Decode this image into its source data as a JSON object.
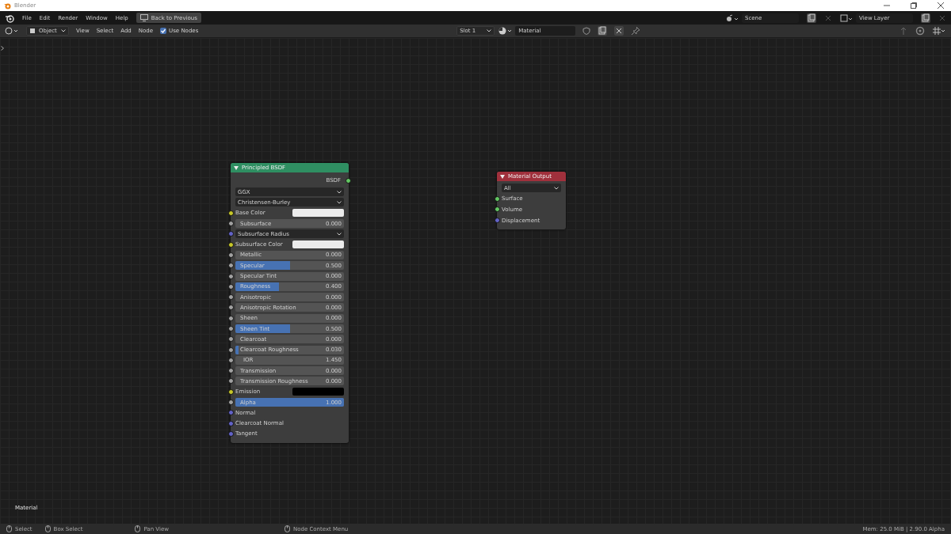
{
  "title_bar": {
    "title": "Blender"
  },
  "menu_bar": {
    "items": [
      "File",
      "Edit",
      "Render",
      "Window",
      "Help"
    ],
    "back_button": "Back to Previous",
    "scene": "Scene",
    "view_layer": "View Layer"
  },
  "header": {
    "mode": "Object",
    "menus": [
      "View",
      "Select",
      "Add",
      "Node"
    ],
    "use_nodes": {
      "label": "Use Nodes",
      "checked": true
    },
    "slot": "Slot 1",
    "material": "Material"
  },
  "principled_node": {
    "title": "Principled BSDF",
    "output": {
      "label": "BSDF",
      "color": "#63c763"
    },
    "rows": [
      {
        "kind": "dropdown",
        "label": "GGX"
      },
      {
        "kind": "dropdown",
        "label": "Christensen-Burley"
      },
      {
        "kind": "color",
        "label": "Base Color",
        "socket": {
          "color": "#c7c729"
        },
        "color": "#ececec"
      },
      {
        "kind": "slider",
        "label": "Subsurface",
        "value": "0.000",
        "socket": {
          "color": "#a1a1a1"
        }
      },
      {
        "kind": "dropdown",
        "label": "Subsurface Radius",
        "socket": {
          "color": "#6363c7"
        }
      },
      {
        "kind": "color",
        "label": "Subsurface Color",
        "socket": {
          "color": "#c7c729"
        },
        "color": "#ececec"
      },
      {
        "kind": "slider",
        "label": "Metallic",
        "value": "0.000",
        "socket": {
          "color": "#a1a1a1"
        }
      },
      {
        "kind": "slider",
        "label": "Specular",
        "value": "0.500",
        "level": 0.5,
        "socket": {
          "color": "#a1a1a1"
        }
      },
      {
        "kind": "slider",
        "label": "Specular Tint",
        "value": "0.000",
        "socket": {
          "color": "#a1a1a1"
        }
      },
      {
        "kind": "slider",
        "label": "Roughness",
        "value": "0.400",
        "level": 0.4,
        "socket": {
          "color": "#a1a1a1"
        }
      },
      {
        "kind": "slider",
        "label": "Anisotropic",
        "value": "0.000",
        "socket": {
          "color": "#a1a1a1"
        }
      },
      {
        "kind": "slider",
        "label": "Anisotropic Rotation",
        "value": "0.000",
        "socket": {
          "color": "#a1a1a1"
        }
      },
      {
        "kind": "slider",
        "label": "Sheen",
        "value": "0.000",
        "socket": {
          "color": "#a1a1a1"
        }
      },
      {
        "kind": "slider",
        "label": "Sheen Tint",
        "value": "0.500",
        "level": 0.5,
        "socket": {
          "color": "#a1a1a1"
        }
      },
      {
        "kind": "slider",
        "label": "Clearcoat",
        "value": "0.000",
        "socket": {
          "color": "#a1a1a1"
        }
      },
      {
        "kind": "slider",
        "label": "Clearcoat Roughness",
        "value": "0.030",
        "level": 0.03,
        "socket": {
          "color": "#a1a1a1"
        }
      },
      {
        "kind": "number",
        "label": "IOR",
        "value": "1.450",
        "socket": {
          "color": "#a1a1a1"
        }
      },
      {
        "kind": "slider",
        "label": "Transmission",
        "value": "0.000",
        "socket": {
          "color": "#a1a1a1"
        }
      },
      {
        "kind": "slider",
        "label": "Transmission Roughness",
        "value": "0.000",
        "socket": {
          "color": "#a1a1a1"
        }
      },
      {
        "kind": "color",
        "label": "Emission",
        "socket": {
          "color": "#c7c729"
        },
        "color": "#000000"
      },
      {
        "kind": "slider",
        "label": "Alpha",
        "value": "1.000",
        "level": 1,
        "socket": {
          "color": "#a1a1a1"
        }
      },
      {
        "kind": "input",
        "label": "Normal",
        "socket": {
          "color": "#6363c7"
        }
      },
      {
        "kind": "input",
        "label": "Clearcoat Normal",
        "socket": {
          "color": "#6363c7"
        }
      },
      {
        "kind": "input",
        "label": "Tangent",
        "socket": {
          "color": "#6363c7"
        }
      }
    ]
  },
  "output_node": {
    "title": "Material Output",
    "target": "All",
    "inputs": [
      {
        "label": "Surface",
        "color": "#63c763"
      },
      {
        "label": "Volume",
        "color": "#63c763"
      },
      {
        "label": "Displacement",
        "color": "#6363c7"
      }
    ]
  },
  "canvas_label": "Material",
  "status_bar": {
    "hints": [
      "Select",
      "Box Select",
      "Pan View",
      "Node Context Menu"
    ],
    "memory": "Mem: 25.0 MiB | 2.90.0 Alpha"
  }
}
